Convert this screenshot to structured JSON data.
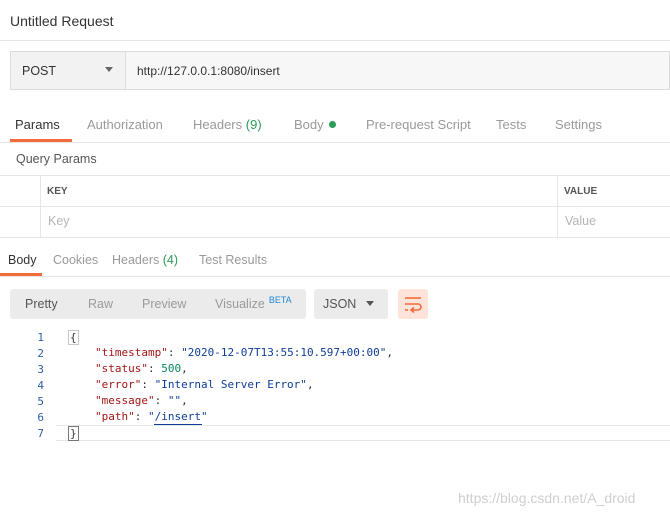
{
  "header": {
    "title": "Untitled Request"
  },
  "request": {
    "method": "POST",
    "url": "http://127.0.0.1:8080/insert"
  },
  "request_tabs": {
    "params": "Params",
    "authorization": "Authorization",
    "headers": "Headers",
    "headers_count": "(9)",
    "body": "Body",
    "prerequest": "Pre-request Script",
    "tests": "Tests",
    "settings": "Settings"
  },
  "query_params": {
    "title": "Query Params",
    "col_key": "KEY",
    "col_value": "VALUE",
    "key_placeholder": "Key",
    "value_placeholder": "Value"
  },
  "response_tabs": {
    "body": "Body",
    "cookies": "Cookies",
    "headers": "Headers",
    "headers_count": "(4)",
    "test_results": "Test Results"
  },
  "view": {
    "pretty": "Pretty",
    "raw": "Raw",
    "preview": "Preview",
    "visualize": "Visualize",
    "beta": "BETA",
    "language": "JSON"
  },
  "code": {
    "line_numbers": [
      "1",
      "2",
      "3",
      "4",
      "5",
      "6",
      "7"
    ],
    "open_brace": "{",
    "close_brace": "}",
    "lines": [
      {
        "key": "\"timestamp\"",
        "value": "\"2020-12-07T13:55:10.597+00:00\"",
        "type": "string"
      },
      {
        "key": "\"status\"",
        "value": "500",
        "type": "number"
      },
      {
        "key": "\"error\"",
        "value": "\"Internal Server Error\"",
        "type": "string"
      },
      {
        "key": "\"message\"",
        "value": "\"\"",
        "type": "string"
      },
      {
        "key": "\"path\"",
        "value": "\"/insert\"",
        "type": "string"
      }
    ]
  },
  "watermark": "https://blog.csdn.net/A_droid",
  "colors": {
    "accent": "#f26b3a",
    "count": "#2b9d56",
    "beta": "#1e88d6"
  },
  "icons": {
    "method_dropdown": "chevron-down-icon",
    "language_dropdown": "chevron-down-icon",
    "wrap": "wrap-lines-icon",
    "body_indicator": "dot-icon"
  }
}
